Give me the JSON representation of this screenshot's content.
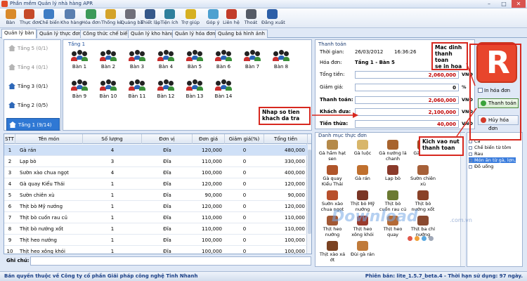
{
  "window": {
    "title": "Phần mềm Quản lý nhà hàng APR",
    "minimize": "–",
    "maximize": "□",
    "close": "✕"
  },
  "toolbar": [
    {
      "label": "Bàn",
      "color": "#d98a2b"
    },
    {
      "label": "Thực đơn",
      "color": "#c54a2a"
    },
    {
      "label": "Chế biến",
      "color": "#3e7cc4"
    },
    {
      "label": "Kho hàng",
      "color": "#5a7fb0"
    },
    {
      "label": "Hóa đơn",
      "color": "#3c9a5a"
    },
    {
      "label": "Thống kê",
      "color": "#d4a32a"
    },
    {
      "label": "Quảng bá",
      "color": "#6f6f7a"
    },
    {
      "label": "Thiết lập",
      "color": "#35588a"
    },
    {
      "label": "Tiện ích",
      "color": "#2f7f9c"
    },
    {
      "label": "Trợ giúp",
      "color": "#d6b021"
    },
    {
      "label": "Góp ý",
      "color": "#4da0d0"
    },
    {
      "label": "Liên hệ",
      "color": "#c23c2a"
    },
    {
      "label": "Thoát",
      "color": "#555b66"
    },
    {
      "label": "Đăng xuất",
      "color": "#2d5fa8"
    }
  ],
  "tabs": [
    {
      "label": "Quản lý bàn",
      "active": true
    },
    {
      "label": "Quản lý thực đơn"
    },
    {
      "label": "Công thức chế biến"
    },
    {
      "label": "Quản lý kho hàng"
    },
    {
      "label": "Quản lý hóa đơn"
    },
    {
      "label": "Quảng bá hình ảnh"
    }
  ],
  "floors": [
    {
      "label": "Tầng 5 (0/1)",
      "style": "gray"
    },
    {
      "label": "Tầng 4 (0/1)",
      "style": "gray"
    },
    {
      "label": "Tầng 3 (0/1)",
      "style": "dark"
    },
    {
      "label": "Tầng 2 (0/5)",
      "style": "dark"
    },
    {
      "label": "Tầng 1 (9/14)",
      "style": "active"
    }
  ],
  "tables_area": {
    "caption": "Tầng 1",
    "tables": [
      "Bàn 1",
      "Bàn 2",
      "Bàn 3",
      "Bàn 4",
      "Bàn 5",
      "Bàn 6",
      "Bàn 7",
      "Bàn 8",
      "Bàn 9",
      "Bàn 10",
      "Bàn 11",
      "Bàn 12",
      "Bàn 13",
      "Bàn 14"
    ]
  },
  "orders": {
    "columns": [
      "STT",
      "Tên món",
      "Số lượng",
      "Đơn vị",
      "Đơn giá",
      "Giảm giá(%)",
      "Tổng tiền"
    ],
    "rows": [
      [
        "1",
        "Gà rán",
        "4",
        "Đĩa",
        "120,000",
        "0",
        "480,000"
      ],
      [
        "2",
        "Lạp bò",
        "3",
        "Đĩa",
        "110,000",
        "0",
        "330,000"
      ],
      [
        "3",
        "Sườn xào chua ngọt",
        "4",
        "Đĩa",
        "100,000",
        "0",
        "400,000"
      ],
      [
        "4",
        "Gà quay Kiểu Thái",
        "1",
        "Đĩa",
        "120,000",
        "0",
        "120,000"
      ],
      [
        "5",
        "Sườn chiên xù",
        "1",
        "Đĩa",
        "90,000",
        "0",
        "90,000"
      ],
      [
        "6",
        "Thịt bò Mỹ nướng",
        "1",
        "Đĩa",
        "120,000",
        "0",
        "120,000"
      ],
      [
        "7",
        "Thịt bò cuốn rau củ",
        "1",
        "Đĩa",
        "110,000",
        "0",
        "110,000"
      ],
      [
        "8",
        "Thịt bò nướng xốt",
        "1",
        "Đĩa",
        "110,000",
        "0",
        "110,000"
      ],
      [
        "9",
        "Thịt heo nướng",
        "1",
        "Đĩa",
        "100,000",
        "0",
        "100,000"
      ],
      [
        "10",
        "Thịt heo xông khói",
        "1",
        "Đĩa",
        "100,000",
        "0",
        "100,000"
      ]
    ],
    "selected_row": 0
  },
  "note": {
    "label": "Ghi chú:",
    "value": ""
  },
  "payment": {
    "title": "Thanh toán",
    "time_label": "Thời gian:",
    "date": "26/03/2012",
    "time": "16:36:26",
    "invoice_label": "Hóa đơn:",
    "invoice_value": "Tầng 1 - Bàn 5",
    "total_label": "Tổng tiền:",
    "total_value": "2,060,000",
    "discount_label": "Giảm giá:",
    "discount_value": "0",
    "discount_unit": "%",
    "pay_label": "Thanh toán:",
    "pay_value": "2,060,000",
    "given_label": "Khách đưa:",
    "given_value": "2,100,000",
    "change_label": "Tiền thừa:",
    "change_value": "40,000",
    "currency": "VNĐ",
    "print_label": "In hóa đơn",
    "pay_button": "Thanh toán",
    "cancel_button": "Hủy hóa đơn"
  },
  "menu": {
    "title": "Danh mục thực đơn",
    "dishes": [
      [
        "Gà hầm hạt sen",
        "#b58a4a"
      ],
      [
        "Gà luộc",
        "#d8b66a"
      ],
      [
        "Gà nướng lá chanh",
        "#a8642e"
      ],
      [
        "Gà quay",
        "#9a4d22"
      ],
      [
        "Gà quay Kiểu Thái",
        "#b0552a"
      ],
      [
        "Gà rán",
        "#c0702e"
      ],
      [
        "Lạp bò",
        "#8a3a2a"
      ],
      [
        "Sườn chiên xù",
        "#a66038"
      ],
      [
        "Sườn xào chua ngọt",
        "#b8502c"
      ],
      [
        "Thịt bò Mỹ nướng",
        "#7a3626"
      ],
      [
        "Thịt bò cuốn rau củ",
        "#6b7a32"
      ],
      [
        "Thịt bò nướng xốt",
        "#8a4228"
      ],
      [
        "Thịt heo nướng",
        "#a25834"
      ],
      [
        "Thịt heo xông khói",
        "#9a3a2c"
      ],
      [
        "Thịt heo quay",
        "#b46a36"
      ],
      [
        "Thịt ba chỉ nướng",
        "#8a4a30"
      ],
      [
        "Thịt xào xả ớt",
        "#7a4222"
      ],
      [
        "Đùi gà rán",
        "#c07a3a"
      ]
    ]
  },
  "categories": [
    {
      "label": "Cá"
    },
    {
      "label": "Chế biến từ tôm"
    },
    {
      "label": "Rau"
    },
    {
      "label": "Món ăn từ gà, lợn,",
      "selected": true
    },
    {
      "label": "Đồ uống"
    }
  ],
  "watermark": {
    "text": "Download",
    "suffix": ".com.vn"
  },
  "callouts": {
    "print_note": "Mac dinh\nthanh toan\nse in hoa",
    "cash_note": "Nhap so tien\nkhach da tra",
    "pay_note": "Kich vao nut\nthanh toan"
  },
  "status": {
    "left": "Bản quyền thuộc về Công ty cổ phần Giải pháp công nghệ Tinh Nhanh",
    "right": "Phiên bản: lite_1.5.7_beta.4 - Thời hạn sử dụng: 97 ngày."
  },
  "colors": {
    "accent": "#2f78d4",
    "callout_border": "#d7281f",
    "amount_red": "#c00000",
    "logo": "#e8452c"
  }
}
